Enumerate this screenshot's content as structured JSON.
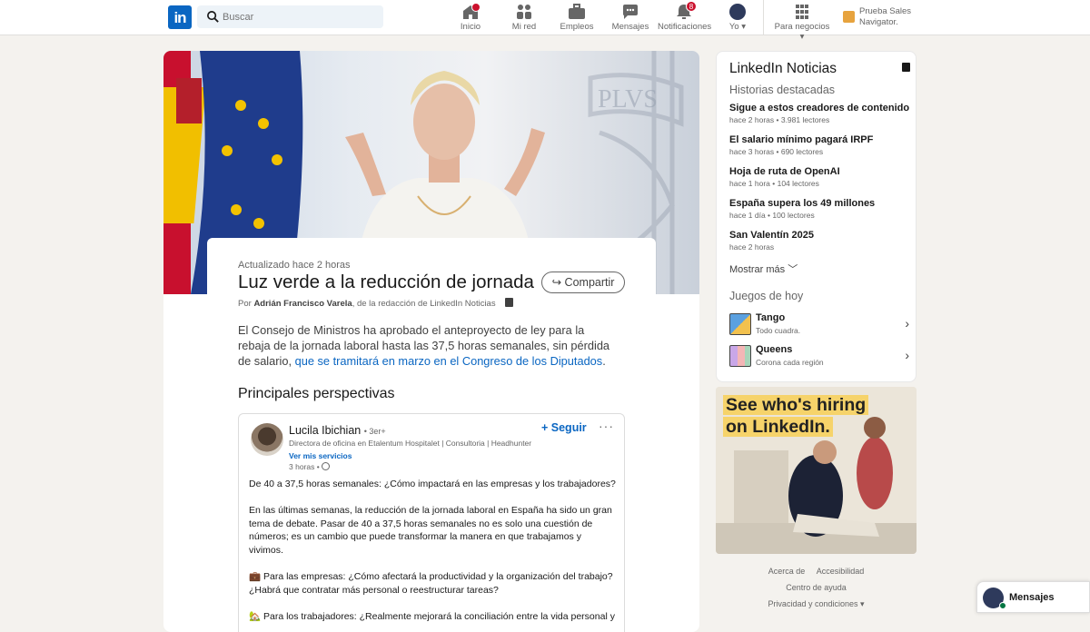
{
  "nav": {
    "logo": "in",
    "search_placeholder": "Buscar",
    "items": [
      {
        "label": "Inicio",
        "icon": "home-icon",
        "badge": ""
      },
      {
        "label": "Mi red",
        "icon": "network-icon",
        "badge": ""
      },
      {
        "label": "Empleos",
        "icon": "briefcase-icon",
        "badge": ""
      },
      {
        "label": "Mensajes",
        "icon": "messaging-icon",
        "badge": ""
      },
      {
        "label": "Notificaciones",
        "icon": "bell-icon",
        "badge": "8"
      },
      {
        "label": "Yo",
        "icon": "avatar",
        "badge": ""
      },
      {
        "label": "Para negocios",
        "icon": "grid-icon",
        "badge": ""
      }
    ],
    "sales": {
      "line1": "Prueba Sales",
      "line2": "Navigator."
    }
  },
  "article": {
    "updated": "Actualizado hace 2 horas",
    "title": "Luz verde a la reducción de jornada",
    "share": "Compartir",
    "byline_prefix": "Por",
    "author": "Adrián Francisco Varela",
    "byline_suffix": ", de la redacción de LinkedIn Noticias",
    "summary": "El Consejo de Ministros ha aprobado el anteproyecto de ley para la rebaja de la jornada laboral hasta las 37,5 horas semanales, sin pérdida de salario, ",
    "summary_link": "que se tramitará en marzo en el Congreso de los Diputados",
    "summary_end": ".",
    "perspectives": "Principales perspectivas"
  },
  "post": {
    "name": "Lucila Ibichian",
    "degree": "• 3er+",
    "role": "Directora de oficina en Etalentum Hospitalet | Consultoria | Headhunter",
    "services": "Ver mis servicios",
    "time": "3 horas •",
    "follow": "+ Seguir",
    "more": "···",
    "paragraphs": [
      "De 40 a 37,5 horas semanales: ¿Cómo impactará en las empresas y los trabajadores?",
      "En las últimas semanas, la reducción de la jornada laboral en España ha sido un gran tema de debate. Pasar de 40 a 37,5 horas semanales no es solo una cuestión de números; es un cambio que puede transformar la manera en que trabajamos y vivimos.",
      "💼 Para las empresas: ¿Cómo afectará la productividad y la organización del trabajo? ¿Habrá que contratar más personal o reestructurar tareas?",
      "🏡 Para los trabajadores: ¿Realmente mejorará la conciliación entre la vida personal y"
    ]
  },
  "news": {
    "title": "LinkedIn Noticias",
    "subtitle": "Historias destacadas",
    "stories": [
      {
        "title": "Sigue a estos creadores de contenido",
        "meta": "hace 2 horas • 3.981 lectores"
      },
      {
        "title": "El salario mínimo pagará IRPF",
        "meta": "hace 3 horas • 690 lectores"
      },
      {
        "title": "Hoja de ruta de OpenAI",
        "meta": "hace 1 hora • 104 lectores"
      },
      {
        "title": "España supera los 49 millones",
        "meta": "hace 1 día • 100 lectores"
      },
      {
        "title": "San Valentín 2025",
        "meta": "hace 2 horas"
      }
    ],
    "show_more": "Mostrar más",
    "games_title": "Juegos de hoy",
    "games": [
      {
        "name": "Tango",
        "desc": "Todo cuadra."
      },
      {
        "name": "Queens",
        "desc": "Corona cada región"
      }
    ]
  },
  "ad": {
    "line1": "See who's hiring",
    "line2": "on LinkedIn."
  },
  "footer": {
    "about": "Acerca de",
    "accessibility": "Accesibilidad",
    "help": "Centro de ayuda",
    "privacy": "Privacidad y condiciones"
  },
  "messaging": {
    "label": "Mensajes"
  },
  "colors": {
    "brand": "#0a66c2",
    "badge": "#cb112d",
    "background": "#f4f2ee"
  }
}
